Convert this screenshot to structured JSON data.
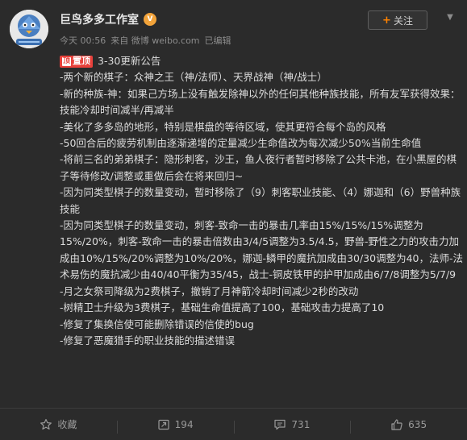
{
  "post": {
    "author": "巨鸟多多工作室",
    "meta": {
      "time": "今天 00:56",
      "source": "来自 微博 weibo.com",
      "edited": "已编辑"
    },
    "follow_label": "关注",
    "pin_label": "置顶",
    "lines": [
      "3-30更新公告",
      "-两个新的棋子：众神之王（神/法师）、天界战神（神/战士）",
      "-新的种族-神：如果己方场上没有触发除神以外的任何其他种族技能，所有友军获得效果：技能冷却时间减半/再减半",
      "-美化了多多岛的地形，特别是棋盘的等待区域，使其更符合每个岛的风格",
      "-50回合后的疲劳机制由逐渐递增的定量减少生命值改为每次减少50%当前生命值",
      "-将前三名的弟弟棋子：隐形刺客，沙王，鱼人夜行者暂时移除了公共卡池，在小黑屋的棋子等待修改/调整或重做后会在将来回归~",
      "-因为同类型棋子的数量变动，暂时移除了（9）刺客职业技能、（4）娜迦和（6）野兽种族技能",
      "-因为同类型棋子的数量变动，刺客-致命一击的暴击几率由15%/15%/15%调整为15%/20%，刺客-致命一击的暴击倍数由3/4/5调整为3.5/4.5，野兽-野性之力的攻击力加成由10%/15%/20%调整为10%/20%，娜迦-鳞甲的魔抗加成由30/30调整为40，法师-法术易伤的魔抗减少由40/40平衡为35/45，战士-铜皮铁甲的护甲加成由6/7/8调整为5/7/9",
      "-月之女祭司降级为2费棋子，撤销了月神箭冷却时间减少2秒的改动",
      "-树精卫士升级为3费棋子，基础生命值提高了100，基础攻击力提高了10",
      "-修复了集换信使可能删除错误的信使的bug",
      "-修复了恶魔猎手的职业技能的描述错误"
    ]
  },
  "actions": {
    "favorite": "收藏",
    "repost": "194",
    "comment": "731",
    "like": "635"
  },
  "colors": {
    "background": "#2b2b2b",
    "accent": "#ff8200",
    "pin": "#e8413b"
  }
}
